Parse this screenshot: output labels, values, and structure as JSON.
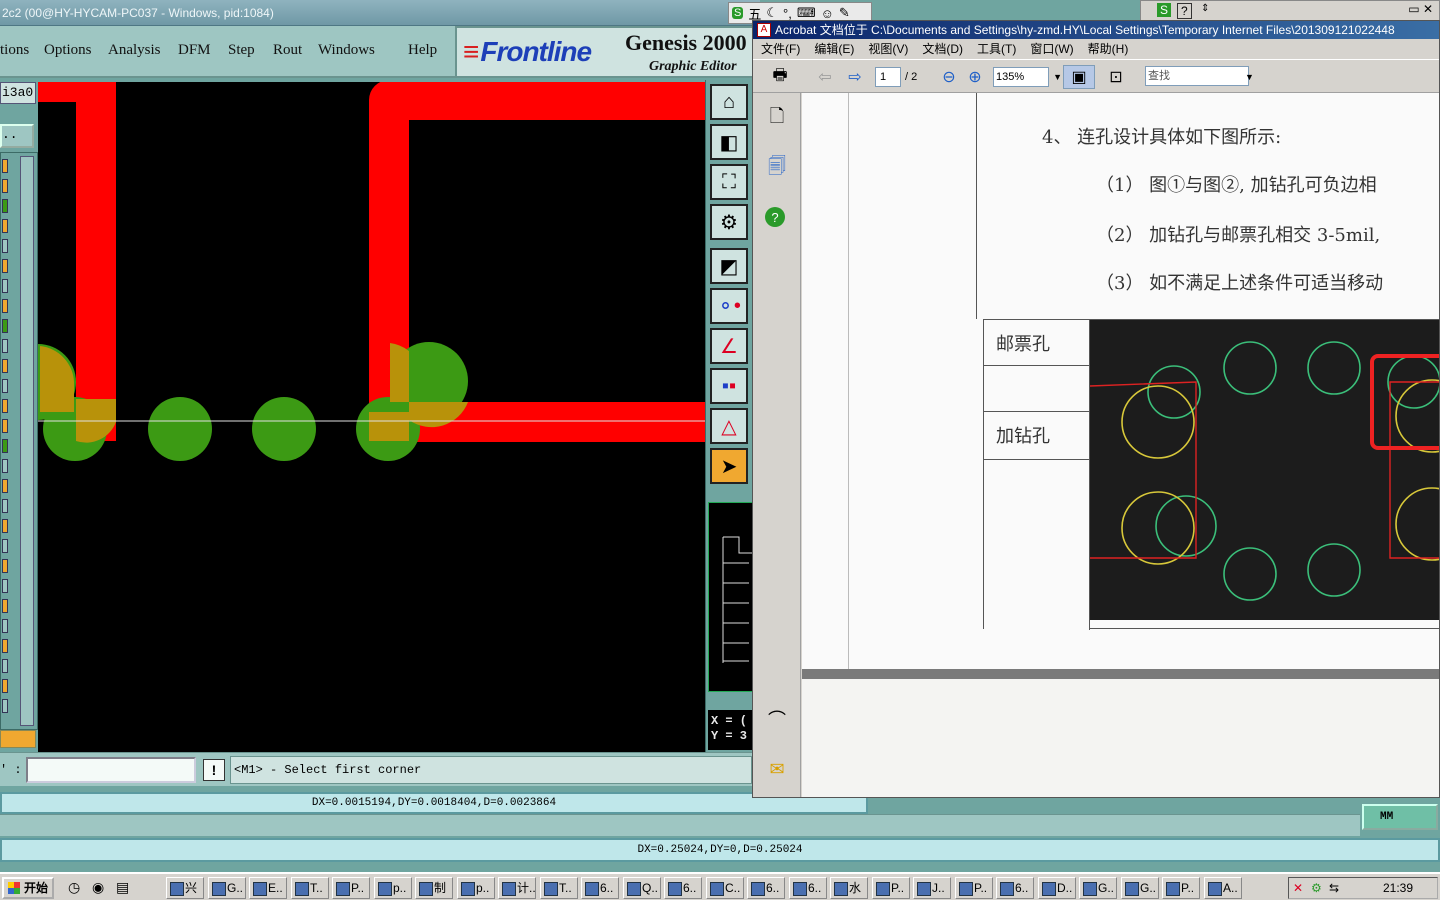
{
  "genesis": {
    "title": "2c2 (00@HY-HYCAM-PC037 - Windows, pid:1084)",
    "menu": [
      "tions",
      "Options",
      "Analysis",
      "DFM",
      "Step",
      "Rout",
      "Windows",
      "Help"
    ],
    "brand": "Frontline",
    "product": "Genesis 2000",
    "subtitle": "Graphic Editor",
    "layer_label": "i3a0",
    "layer_button": "..",
    "coord_x": "X = (",
    "coord_y": "Y = 3",
    "command_prefix": "' :",
    "command_prompt": "<M1> - Select first corner",
    "info_button": "!",
    "measure_upper": "DX=0.0015194,DY=0.0018404,D=0.0023864",
    "measure_lower": "DX=0.25024,DY=0,D=0.25024",
    "unit": "MM",
    "colors": {
      "trace": "#ff0000",
      "pad": "#3c9a14",
      "pad_overlap": "#b8920a",
      "canvas": "#000000"
    }
  },
  "ime": {
    "label": "五"
  },
  "acrobat": {
    "title": "Acrobat 文档位于 C:\\Documents and Settings\\hy-zmd.HY\\Local Settings\\Temporary Internet Files\\201309121022448",
    "menu": [
      "文件(F)",
      "编辑(E)",
      "视图(V)",
      "文档(D)",
      "工具(T)",
      "窗口(W)",
      "帮助(H)"
    ],
    "page_current": "1",
    "page_total": "/ 2",
    "zoom": "135%",
    "find_placeholder": "查找",
    "doc": {
      "heading": "4、 连孔设计具体如下图所示:",
      "item1": "（1）  图①与图②, 加钻孔可负边相",
      "item2": "（2）  加钻孔与邮票孔相交 3-5mil,",
      "item3": "（3）  如不满足上述条件可适当移动",
      "label_stamp": "邮票孔",
      "label_drill": "加钻孔"
    }
  },
  "taskbar": {
    "start": "开始",
    "items": [
      "兴",
      "G..",
      "E..",
      "T..",
      "P..",
      "p..",
      "制",
      "p..",
      "计..",
      "T..",
      "6..",
      "Q..",
      "6..",
      "C..",
      "6..",
      "6..",
      "水",
      "P..",
      "J..",
      "P..",
      "6..",
      "D..",
      "G..",
      "G..",
      "P..",
      "A.."
    ],
    "clock": "21:39"
  }
}
